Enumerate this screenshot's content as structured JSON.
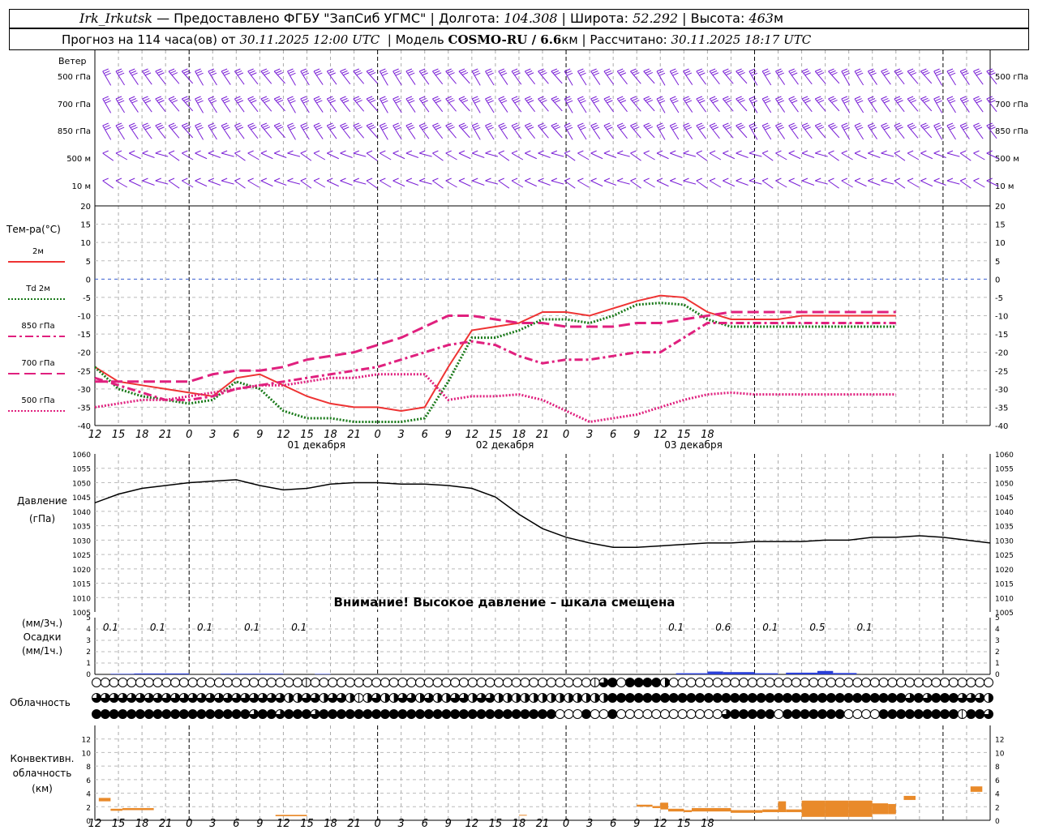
{
  "header": {
    "station": "Irk_Irkutsk",
    "dash": "—",
    "provider": "Предоставлено ФГБУ \"ЗапСиб УГМС\"",
    "lon_label": "Долгота:",
    "lon": "104.308",
    "lat_label": "Широта:",
    "lat": "52.292",
    "alt_label": "Высота:",
    "alt": "463",
    "alt_unit": "м",
    "forecast_label": "Прогноз на 114 часа(ов) от",
    "forecast_from": "30.11.2025 12:00 UTC",
    "model_label": "Модель",
    "model": "COSMO-RU / 6.6",
    "model_unit": "км",
    "computed_label": "Рассчитано:",
    "computed": "30.11.2025 18:17 UTC"
  },
  "time_axis": {
    "hour_labels": [
      "12",
      "15",
      "18",
      "21",
      "0",
      "3",
      "6",
      "9",
      "12",
      "15",
      "18",
      "21",
      "0",
      "3",
      "6",
      "9",
      "12",
      "15",
      "18",
      "21",
      "0",
      "3",
      "6",
      "9",
      "12",
      "15",
      "18"
    ],
    "dates": [
      {
        "label": "01 декабря",
        "hour_index": 28
      },
      {
        "label": "02 декабря",
        "hour_index": 52
      },
      {
        "label": "03 декабря",
        "hour_index": 76
      }
    ]
  },
  "chart_data": [
    {
      "type": "wind_barbs",
      "title": "Ветер",
      "levels": [
        "500 гПа",
        "700 гПа",
        "850 гПа",
        "500 м",
        "10 м"
      ],
      "color": "#7a1fd6"
    },
    {
      "type": "line",
      "title": "Тем-ра(°C)",
      "ylim": [
        -40,
        20
      ],
      "yticks": [
        20,
        15,
        10,
        5,
        0,
        -5,
        -10,
        -15,
        -20,
        -25,
        -30,
        -35,
        -40
      ],
      "x_hours": [
        0,
        3,
        6,
        9,
        12,
        15,
        18,
        21,
        24,
        27,
        30,
        33,
        36,
        39,
        42,
        45,
        48,
        51,
        54,
        57,
        60,
        63,
        66,
        69,
        72,
        75,
        78,
        81,
        84,
        87,
        90,
        93,
        96,
        99,
        102
      ],
      "series": [
        {
          "name": "2м",
          "color": "#ee3333",
          "dash": "solid",
          "values": [
            -24,
            -28,
            -29,
            -30,
            -31,
            -32,
            -27,
            -26,
            -29,
            -32,
            -34,
            -35,
            -35,
            -36,
            -35,
            -24,
            -14,
            -13,
            -12,
            -9,
            -9,
            -10,
            -8,
            -6,
            -4.5,
            -5,
            -9,
            -11,
            -11,
            -11,
            -10,
            -10,
            -10,
            -10,
            -10
          ]
        },
        {
          "name": "Td  2м",
          "color": "#1a7a1a",
          "dash": "dotted",
          "values": [
            -24,
            -30,
            -32,
            -33,
            -34,
            -33,
            -28,
            -30,
            -36,
            -38,
            -38,
            -39,
            -39,
            -39,
            -38,
            -28,
            -16,
            -16,
            -14,
            -11,
            -11,
            -12,
            -10,
            -7,
            -6.5,
            -7,
            -11,
            -13,
            -13,
            -13,
            -13,
            -13,
            -13,
            -13,
            -13
          ]
        },
        {
          "name": "850 гПа",
          "color": "#e0207e",
          "dash": "dashdot",
          "values": [
            -27,
            -29,
            -31,
            -33,
            -33,
            -32,
            -30,
            -29,
            -28,
            -27,
            -26,
            -25,
            -24,
            -22,
            -20,
            -18,
            -17,
            -18,
            -21,
            -23,
            -22,
            -22,
            -21,
            -20,
            -20,
            -16,
            -12,
            -12,
            -12,
            -12,
            -12,
            -12,
            -12,
            -12,
            -12
          ]
        },
        {
          "name": "700 гПа",
          "color": "#e0207e",
          "dash": "longdash",
          "values": [
            -28,
            -28,
            -28,
            -28,
            -28,
            -26,
            -25,
            -25,
            -24,
            -22,
            -21,
            -20,
            -18,
            -16,
            -13,
            -10,
            -10,
            -11,
            -12,
            -12,
            -13,
            -13,
            -13,
            -12,
            -12,
            -11,
            -10,
            -9,
            -9,
            -9,
            -9,
            -9,
            -9,
            -9,
            -9
          ]
        },
        {
          "name": "500 гПа",
          "color": "#e0207e",
          "dash": "dotted",
          "values": [
            -35,
            -34,
            -33,
            -33,
            -32,
            -31,
            -30,
            -29,
            -29,
            -28,
            -27,
            -27,
            -26,
            -26,
            -26,
            -33,
            -32,
            -32,
            -31.5,
            -33,
            -36,
            -39,
            -38,
            -37,
            -35,
            -33,
            -31.5,
            -31,
            -31.5,
            -31.5,
            -31.5,
            -31.5,
            -31.5,
            -31.5,
            -31.5
          ]
        }
      ]
    },
    {
      "type": "line",
      "title": "Давление",
      "ylabel": "(гПа)",
      "ylim": [
        1005,
        1060
      ],
      "yticks": [
        1060,
        1055,
        1050,
        1045,
        1040,
        1035,
        1030,
        1025,
        1020,
        1015,
        1010,
        1005
      ],
      "annotation": "Внимание! Высокое давление – шкала смещена",
      "series": [
        {
          "name": "",
          "color": "#000000",
          "dash": "solid",
          "x_hours": [
            0,
            3,
            6,
            9,
            12,
            15,
            18,
            21,
            24,
            27,
            30,
            33,
            36,
            39,
            42,
            45,
            48,
            51,
            54,
            57,
            60,
            63,
            66,
            69,
            72,
            75,
            78,
            81,
            84,
            87,
            90,
            93,
            96,
            99,
            102,
            105,
            108,
            111,
            114
          ],
          "values": [
            1043,
            1046,
            1048,
            1049,
            1050,
            1050.5,
            1051,
            1049,
            1047.5,
            1048,
            1049.5,
            1050,
            1050,
            1049.5,
            1049.5,
            1049,
            1048,
            1045,
            1039,
            1034,
            1031,
            1029,
            1027.5,
            1027.5,
            1028,
            1028.5,
            1029,
            1029,
            1029.5,
            1029.5,
            1029.5,
            1030,
            1030,
            1031,
            1031,
            1031.5,
            1031,
            1030,
            1029
          ]
        }
      ]
    },
    {
      "type": "bar",
      "title": "Осадки",
      "ylabel_top": "(мм/3ч.)",
      "ylabel_bottom": "(мм/1ч.)",
      "ylim": [
        0,
        5
      ],
      "yticks": [
        5,
        4,
        3,
        2,
        1,
        0
      ],
      "labels_3h": [
        {
          "hour": 3,
          "value": "0.1"
        },
        {
          "hour": 9,
          "value": "0.1"
        },
        {
          "hour": 15,
          "value": "0.1"
        },
        {
          "hour": 21,
          "value": "0.1"
        },
        {
          "hour": 27,
          "value": "0.1"
        },
        {
          "hour": 75,
          "value": "0.1"
        },
        {
          "hour": 81,
          "value": "0.6"
        },
        {
          "hour": 87,
          "value": "0.1"
        },
        {
          "hour": 93,
          "value": "0.5"
        },
        {
          "hour": 99,
          "value": "0.1"
        }
      ],
      "bars_1h": [
        {
          "hour_start": 2,
          "hour_end": 5,
          "value": 0.05
        },
        {
          "hour_start": 5,
          "hour_end": 12,
          "value": 0.08
        },
        {
          "hour_start": 16,
          "hour_end": 24,
          "value": 0.06
        },
        {
          "hour_start": 28,
          "hour_end": 30,
          "value": 0.04
        },
        {
          "hour_start": 74,
          "hour_end": 78,
          "value": 0.1
        },
        {
          "hour_start": 78,
          "hour_end": 80,
          "value": 0.25
        },
        {
          "hour_start": 80,
          "hour_end": 84,
          "value": 0.2
        },
        {
          "hour_start": 84,
          "hour_end": 87,
          "value": 0.1
        },
        {
          "hour_start": 88,
          "hour_end": 92,
          "value": 0.15
        },
        {
          "hour_start": 92,
          "hour_end": 94,
          "value": 0.3
        },
        {
          "hour_start": 94,
          "hour_end": 97,
          "value": 0.12
        }
      ]
    },
    {
      "type": "cloud_symbols",
      "title": "Облачность",
      "rows": [
        "0000000000000000000000001000000000000000000000000000000001340444420000000000000000000000000000000000000",
        "3333333333333333333333223323321232233232233233222222222222244444444444444444444444444444444443434443332",
        "4444444444444444443443444344444444444444444444444444400040040000000000003444440444444400004444444441443"
      ]
    },
    {
      "type": "bar",
      "title": "Конвективн. облачность",
      "ylabel": "(км)",
      "ylim": [
        0,
        14
      ],
      "yticks": [
        12,
        10,
        8,
        6,
        4,
        2,
        0
      ],
      "color": "#e98a2a",
      "bars": [
        {
          "hour_start": 0.5,
          "hour_end": 2,
          "base": 2.8,
          "top": 3.3
        },
        {
          "hour_start": 2,
          "hour_end": 3.5,
          "base": 1.4,
          "top": 1.7
        },
        {
          "hour_start": 3.5,
          "hour_end": 7.5,
          "base": 1.5,
          "top": 1.8
        },
        {
          "hour_start": 23,
          "hour_end": 27,
          "base": 0.6,
          "top": 0.8
        },
        {
          "hour_start": 54,
          "hour_end": 55,
          "base": 0.7,
          "top": 0.8
        },
        {
          "hour_start": 69,
          "hour_end": 71,
          "base": 2.0,
          "top": 2.3
        },
        {
          "hour_start": 71,
          "hour_end": 72,
          "base": 1.8,
          "top": 2.1
        },
        {
          "hour_start": 72,
          "hour_end": 73,
          "base": 1.6,
          "top": 2.6
        },
        {
          "hour_start": 73,
          "hour_end": 75,
          "base": 1.3,
          "top": 1.7
        },
        {
          "hour_start": 75,
          "hour_end": 76,
          "base": 1.2,
          "top": 1.5
        },
        {
          "hour_start": 76,
          "hour_end": 81,
          "base": 1.3,
          "top": 1.8
        },
        {
          "hour_start": 81,
          "hour_end": 85,
          "base": 1.1,
          "top": 1.5
        },
        {
          "hour_start": 85,
          "hour_end": 87,
          "base": 1.2,
          "top": 1.6
        },
        {
          "hour_start": 87,
          "hour_end": 88,
          "base": 1.2,
          "top": 2.8
        },
        {
          "hour_start": 88,
          "hour_end": 90,
          "base": 1.2,
          "top": 1.6
        },
        {
          "hour_start": 90,
          "hour_end": 93,
          "base": 0.5,
          "top": 2.9
        },
        {
          "hour_start": 93,
          "hour_end": 96,
          "base": 0.5,
          "top": 2.9
        },
        {
          "hour_start": 96,
          "hour_end": 99,
          "base": 0.5,
          "top": 2.9
        },
        {
          "hour_start": 99,
          "hour_end": 101,
          "base": 0.9,
          "top": 2.5
        },
        {
          "hour_start": 101,
          "hour_end": 102,
          "base": 0.9,
          "top": 2.4
        },
        {
          "hour_start": 103,
          "hour_end": 104.5,
          "base": 3.0,
          "top": 3.6
        },
        {
          "hour_start": 111.5,
          "hour_end": 113,
          "base": 4.2,
          "top": 5.0
        }
      ]
    }
  ]
}
